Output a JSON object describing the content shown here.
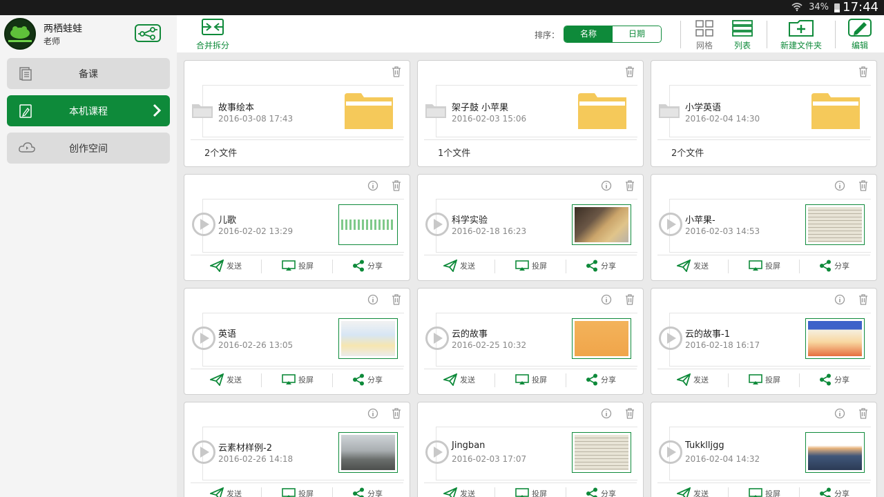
{
  "status": {
    "battery": "34%",
    "time": "17:44"
  },
  "user": {
    "name": "两栖蛙蛙",
    "role": "老师"
  },
  "nav": [
    {
      "label": "备课",
      "icon": "document-icon",
      "active": false
    },
    {
      "label": "本机课程",
      "icon": "edit-doc-icon",
      "active": true
    },
    {
      "label": "创作空间",
      "icon": "cloud-icon",
      "active": false
    }
  ],
  "toolbar": {
    "merge_split": "合并拆分",
    "sort_label": "排序：",
    "sort_by_name": "名称",
    "sort_by_date": "日期",
    "view_grid": "网格",
    "view_list": "列表",
    "new_folder": "新建文件夹",
    "edit": "编辑"
  },
  "folders": [
    {
      "title": "故事绘本",
      "date": "2016-03-08 17:43",
      "count": "2个文件"
    },
    {
      "title": "架子鼓 小苹果",
      "date": "2016-02-03 15:06",
      "count": "1个文件"
    },
    {
      "title": "小学英语",
      "date": "2016-02-04 14:30",
      "count": "2个文件"
    }
  ],
  "courses": [
    {
      "title": "儿歌",
      "date": "2016-02-02 13:29",
      "thumb": "music-bars"
    },
    {
      "title": "科学实验",
      "date": "2016-02-18 16:23",
      "thumb": "photo-hand"
    },
    {
      "title": "小苹果-",
      "date": "2016-02-03 14:53",
      "thumb": "sheet-music"
    },
    {
      "title": "英语",
      "date": "2016-02-26 13:05",
      "thumb": "book-page"
    },
    {
      "title": "云的故事",
      "date": "2016-02-25 10:32",
      "thumb": "orange-doc"
    },
    {
      "title": "云的故事-1",
      "date": "2016-02-18 16:17",
      "thumb": "colorful-slide"
    },
    {
      "title": "云素材样例-2",
      "date": "2016-02-26 14:18",
      "thumb": "city-photo"
    },
    {
      "title": "Jingban",
      "date": "2016-02-03 17:07",
      "thumb": "sheet-music"
    },
    {
      "title": "Tukklljgg",
      "date": "2016-02-04 14:32",
      "thumb": "classroom-photo"
    }
  ],
  "actions": {
    "send": "发送",
    "cast": "投屏",
    "share": "分享"
  },
  "colors": {
    "accent": "#0e8a3a",
    "folder": "#f5c95a"
  }
}
